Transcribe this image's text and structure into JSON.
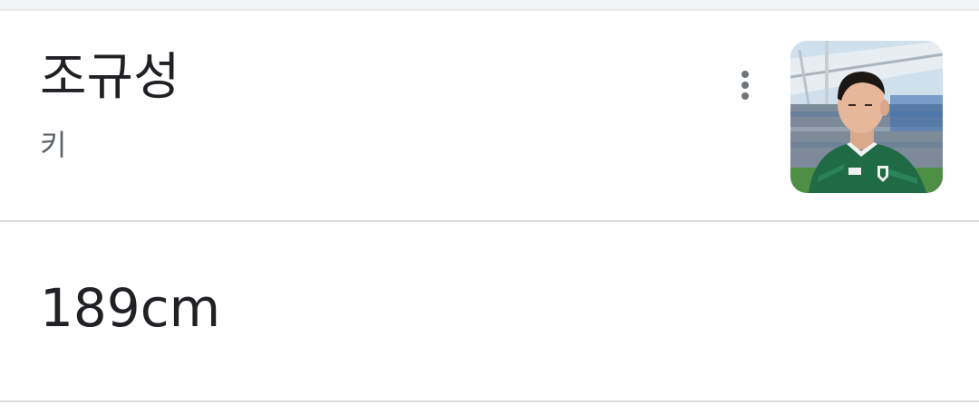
{
  "entity": {
    "name": "조규성",
    "attribute": "키",
    "more_options_icon": "more-vert-icon",
    "image_alt": "player-photo"
  },
  "answer": {
    "value": "189cm"
  },
  "colors": {
    "text_primary": "#202124",
    "text_secondary": "#5f6368",
    "divider": "#dadce0",
    "jersey_green": "#1e6b45"
  }
}
